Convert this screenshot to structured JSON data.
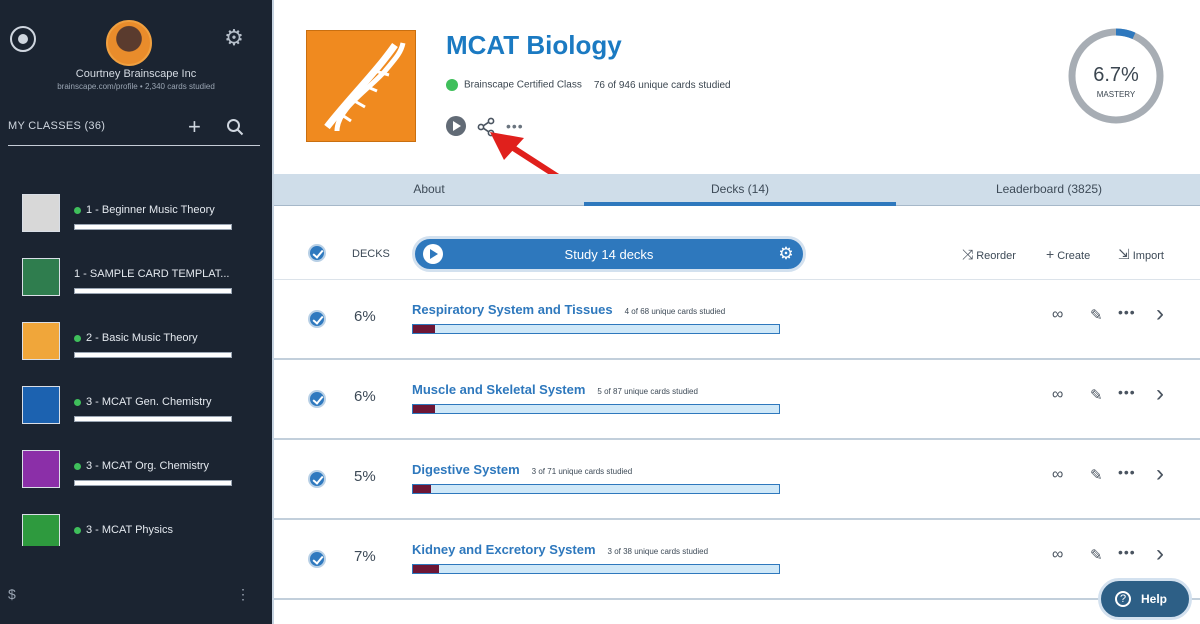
{
  "sidebar": {
    "user_name": "Courtney Brainscape Inc",
    "user_sub": "brainscape.com/profile • 2,340 cards studied",
    "classes_label": "MY CLASSES (36)",
    "add_label": "+",
    "items": [
      {
        "label": "1 - Beginner Music Theory",
        "thumb_color": "#d8d8d8",
        "certified": true
      },
      {
        "label": "1 - SAMPLE CARD TEMPLAT...",
        "thumb_color": "#2f7d4e",
        "certified": false
      },
      {
        "label": "2 - Basic Music Theory",
        "thumb_color": "#f0a63a",
        "certified": true
      },
      {
        "label": "3 - MCAT Gen. Chemistry",
        "thumb_color": "#1c62b0",
        "certified": true
      },
      {
        "label": "3 - MCAT Org. Chemistry",
        "thumb_color": "#8b2fa8",
        "certified": true
      },
      {
        "label": "3 - MCAT Physics",
        "thumb_color": "#2e9a3e",
        "certified": true
      }
    ],
    "bottom_left": "$",
    "bottom_right": "⋮"
  },
  "header": {
    "title": "MCAT Biology",
    "certified_label": "Brainscape Certified Class",
    "studied_label": "76 of 946 unique cards studied",
    "more": "•••"
  },
  "mastery": {
    "percent": "6.7%",
    "label": "MASTERY",
    "value": 0.067
  },
  "tabs": [
    {
      "label": "About"
    },
    {
      "label": "Decks (14)"
    },
    {
      "label": "Leaderboard (3825)"
    }
  ],
  "decks_bar": {
    "label": "DECKS",
    "study_label": "Study 14 decks",
    "reorder_label": "Reorder",
    "create_label": "Create",
    "import_label": "Import"
  },
  "decks": [
    {
      "pct": "6%",
      "name": "Respiratory System and Tissues",
      "count": "4 of 68 unique cards studied",
      "progress": 0.06
    },
    {
      "pct": "6%",
      "name": "Muscle and Skeletal System",
      "count": "5 of 87 unique cards studied",
      "progress": 0.06
    },
    {
      "pct": "5%",
      "name": "Digestive System",
      "count": "3 of 71 unique cards studied",
      "progress": 0.05
    },
    {
      "pct": "7%",
      "name": "Kidney and Excretory System",
      "count": "3 of 38 unique cards studied",
      "progress": 0.07
    }
  ],
  "help": {
    "label": "Help",
    "icon": "?"
  },
  "colors": {
    "sidebar_bg": "#1b2431",
    "accent": "#2e78bd",
    "cover": "#f08a1f",
    "progress_fill": "#6d1635",
    "certified": "#3fbf5b",
    "arrow": "#e0201c"
  }
}
